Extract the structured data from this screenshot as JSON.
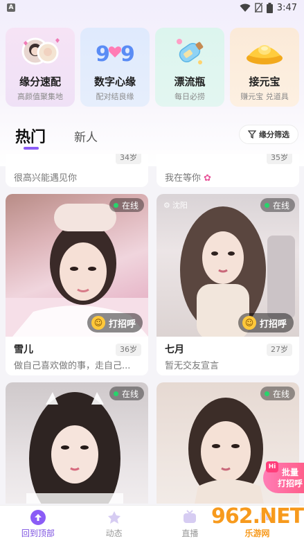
{
  "status_bar": {
    "time": "3:47",
    "app_badge": "A"
  },
  "features": [
    {
      "title": "缘分速配",
      "subtitle": "高颜值聚集地",
      "icon": "avatars-hearts-icon"
    },
    {
      "title": "数字心缘",
      "subtitle": "配对结良缘",
      "icon": "number-999-icon"
    },
    {
      "title": "漂流瓶",
      "subtitle": "每日必捞",
      "icon": "drift-bottle-icon"
    },
    {
      "title": "接元宝",
      "subtitle": "赚元宝 兑道具",
      "icon": "gold-ingot-icon"
    }
  ],
  "tabs": {
    "hot": "热门",
    "new": "新人"
  },
  "filter": {
    "label": "缘分筛选"
  },
  "cards": [
    {
      "name": "",
      "desc": "很高兴能遇见你",
      "age": "34岁",
      "partial": true
    },
    {
      "name": "",
      "desc": "我在等你",
      "age": "35岁",
      "partial": true
    },
    {
      "name": "雪儿",
      "desc": "做自己喜欢做的事，走自己...",
      "age": "36岁",
      "online": "在线",
      "greet": "打招呼"
    },
    {
      "name": "七月",
      "desc": "暂无交友宣言",
      "age": "27岁",
      "online": "在线",
      "greet": "打招呼",
      "location": "沈阳"
    },
    {
      "name": "",
      "desc": "",
      "age": "",
      "online": "在线"
    },
    {
      "name": "",
      "desc": "",
      "age": "",
      "online": "在线"
    }
  ],
  "batch_greet": {
    "hi": "Hi",
    "line1": "批量",
    "line2": "打招呼"
  },
  "bottom_nav": [
    {
      "label": "回到顶部",
      "icon": "arrow-up-icon",
      "active": true
    },
    {
      "label": "动态",
      "icon": "dynamic-icon",
      "active": false
    },
    {
      "label": "直播",
      "icon": "live-tv-icon",
      "active": false
    },
    {
      "label": "",
      "icon": "chat-icon",
      "active": false
    }
  ],
  "watermark": {
    "big": "962.NET",
    "small": "乐游网"
  },
  "colors": {
    "accent": "#8b5cf6",
    "online_dot": "#27d46b",
    "brand_orange": "#f79a1d"
  }
}
